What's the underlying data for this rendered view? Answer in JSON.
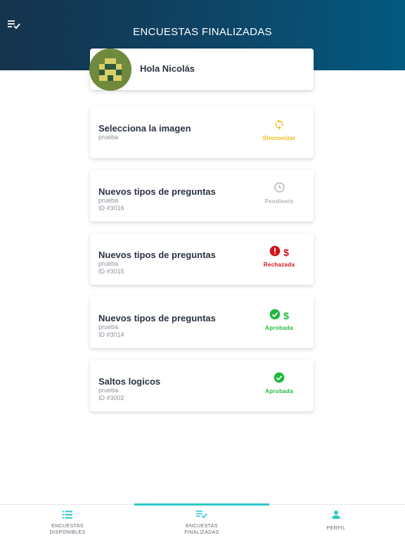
{
  "header": {
    "title": "ENCUESTAS FINALIZADAS",
    "menu_icon": "playlist-check-icon"
  },
  "greeting": {
    "text": "Hola Nicolás",
    "avatar_icon": "pixel-identicon-avatar"
  },
  "surveys": [
    {
      "title": "Selecciona la imagen",
      "subtitle": "prueba",
      "id": "",
      "status_label": "Sincronizar",
      "status_icon": "sync-icon",
      "payment_icon": "",
      "color": "#f2b705"
    },
    {
      "title": "Nuevos tipos de preguntas",
      "subtitle": "prueba",
      "id": "ID #3016",
      "status_label": "Pendiente",
      "status_icon": "clock-icon",
      "payment_icon": "",
      "color": "#b0b5ba"
    },
    {
      "title": "Nuevos tipos de preguntas",
      "subtitle": "prueba",
      "id": "ID #3015",
      "status_label": "Rechazada",
      "status_icon": "alert-circle-icon",
      "payment_icon": "$",
      "color": "#d0131b"
    },
    {
      "title": "Nuevos tipos de preguntas",
      "subtitle": "prueba",
      "id": "ID #3014",
      "status_label": "Aprobada",
      "status_icon": "check-circle-icon",
      "payment_icon": "$",
      "color": "#1fb83a"
    },
    {
      "title": "Saltos logicos",
      "subtitle": "prueba",
      "id": "ID #3002",
      "status_label": "Aprobada",
      "status_icon": "check-circle-icon",
      "payment_icon": "",
      "color": "#1fb83a"
    }
  ],
  "bottom_nav": {
    "items": [
      {
        "label_line1": "ENCUESTAS",
        "label_line2": "DISPONIBLES",
        "icon": "list-icon",
        "active": false
      },
      {
        "label_line1": "ENCUESTAS",
        "label_line2": "FINALIZADAS",
        "icon": "playlist-check-icon",
        "active": true
      },
      {
        "label_line1": "PERFIL",
        "label_line2": "",
        "icon": "person-icon",
        "active": false
      }
    ],
    "accent": "#2ac9c4"
  },
  "colors": {
    "header_gradient_start": "#15334d",
    "header_gradient_end": "#035a80"
  }
}
